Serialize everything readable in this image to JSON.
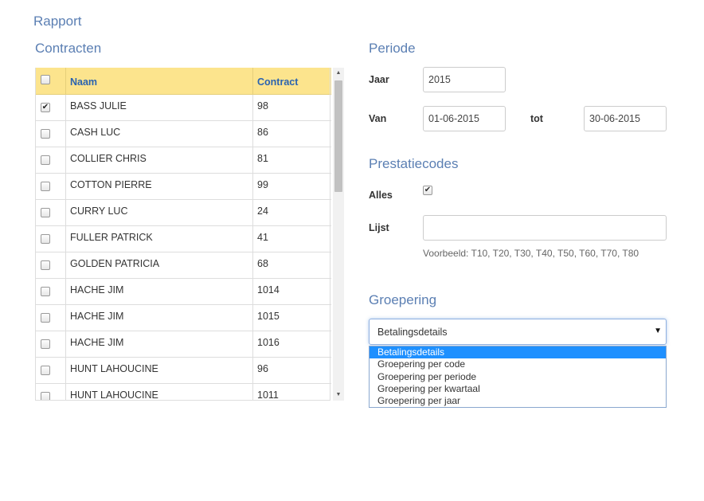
{
  "page": {
    "title": "Rapport"
  },
  "contracten": {
    "title": "Contracten",
    "columns": {
      "naam": "Naam",
      "contract": "Contract"
    },
    "rows": [
      {
        "checked": true,
        "naam": "BASS JULIE",
        "contract": "98"
      },
      {
        "checked": false,
        "naam": "CASH LUC",
        "contract": "86"
      },
      {
        "checked": false,
        "naam": "COLLIER CHRIS",
        "contract": "81"
      },
      {
        "checked": false,
        "naam": "COTTON PIERRE",
        "contract": "99"
      },
      {
        "checked": false,
        "naam": "CURRY LUC",
        "contract": "24"
      },
      {
        "checked": false,
        "naam": "FULLER PATRICK",
        "contract": "41"
      },
      {
        "checked": false,
        "naam": "GOLDEN PATRICIA",
        "contract": "68"
      },
      {
        "checked": false,
        "naam": "HACHE JIM",
        "contract": "1014"
      },
      {
        "checked": false,
        "naam": "HACHE JIM",
        "contract": "1015"
      },
      {
        "checked": false,
        "naam": "HACHE JIM",
        "contract": "1016"
      },
      {
        "checked": false,
        "naam": "HUNT LAHOUCINE",
        "contract": "96"
      },
      {
        "checked": false,
        "naam": "HUNT LAHOUCINE",
        "contract": "1011"
      }
    ]
  },
  "periode": {
    "title": "Periode",
    "jaar_label": "Jaar",
    "jaar_value": "2015",
    "van_label": "Van",
    "van_value": "01-06-2015",
    "tot_label": "tot",
    "tot_value": "30-06-2015"
  },
  "prestatiecodes": {
    "title": "Prestatiecodes",
    "alles_label": "Alles",
    "alles_checked": true,
    "lijst_label": "Lijst",
    "lijst_value": "",
    "hint": "Voorbeeld: T10, T20, T30, T40, T50, T60, T70, T80"
  },
  "groepering": {
    "title": "Groepering",
    "selected": "Betalingsdetails",
    "options": [
      "Betalingsdetails",
      "Groepering per code",
      "Groepering per periode",
      "Groepering per kwartaal",
      "Groepering per jaar"
    ]
  },
  "colors": {
    "accent": "#5b7fb3",
    "header_bg": "#fce48d",
    "header_text": "#2a63b0",
    "selected_option": "#1e90ff"
  }
}
